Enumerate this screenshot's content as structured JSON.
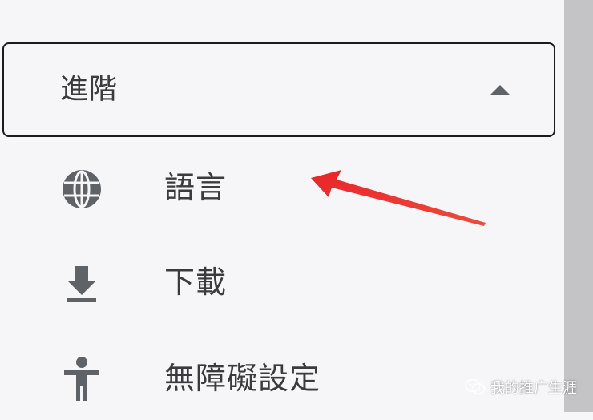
{
  "colors": {
    "background": "#f6f5f7",
    "text": "#3b3b3f",
    "icon": "#5f6368",
    "header_border": "#1b1b1b",
    "scrollbar": "#c4c3c6",
    "annotation_arrow": "#e8242a"
  },
  "advanced": {
    "label": "進階",
    "toggle_icon": "caret-up-icon"
  },
  "menu": {
    "items": [
      {
        "label": "語言",
        "icon": "globe-icon"
      },
      {
        "label": "下載",
        "icon": "download-icon"
      },
      {
        "label": "無障礙設定",
        "icon": "accessibility-icon"
      }
    ]
  },
  "watermark": {
    "text": "我的推广生涯",
    "icon": "wechat-icon"
  }
}
